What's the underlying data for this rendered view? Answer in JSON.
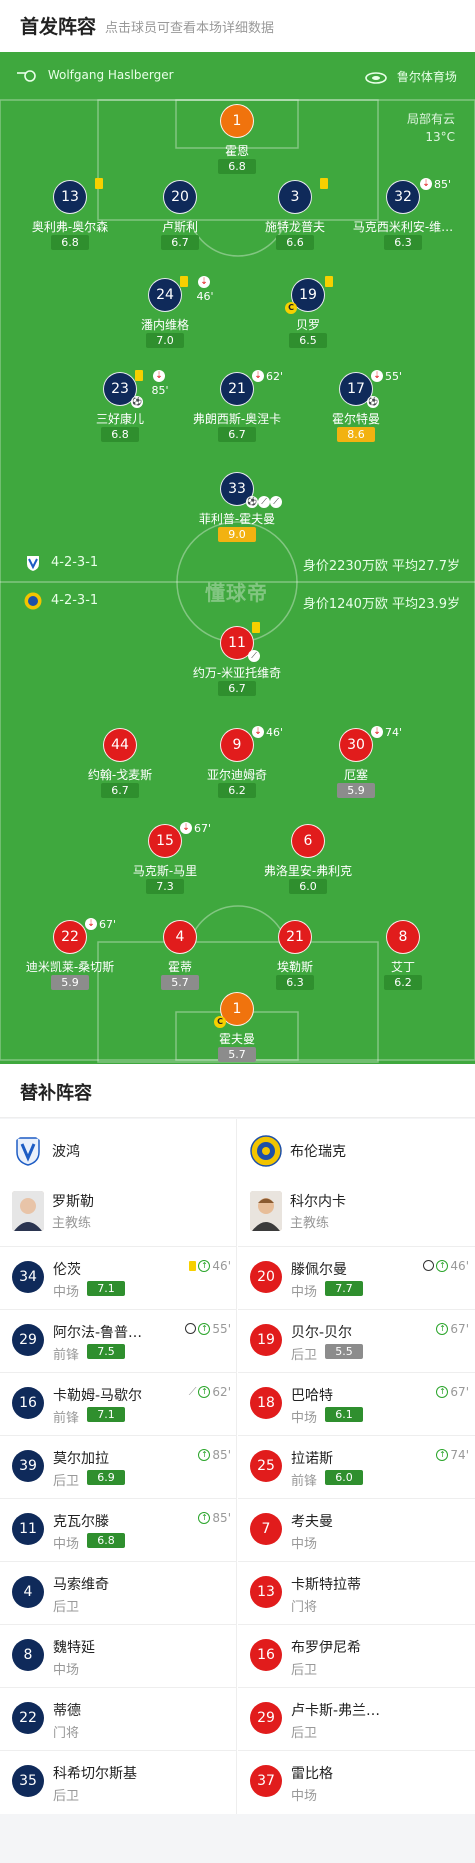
{
  "header": {
    "title": "首发阵容",
    "hint": "点击球员可查看本场详细数据"
  },
  "match_info": {
    "referee": "Wolfgang Haslberger",
    "venue": "鲁尔体育场",
    "weather": "局部有云",
    "temperature": "13°C"
  },
  "home_team": {
    "formation": "4-2-3-1",
    "value": "身价2230万欧 平均27.7岁"
  },
  "away_team": {
    "formation": "4-2-3-1",
    "value": "身价1240万欧 平均23.9岁"
  },
  "watermark": "懂球帝",
  "home_players": [
    {
      "number": "1",
      "name": "霍恩",
      "rating": "6.8"
    },
    {
      "number": "13",
      "name": "奥利弗-奥尔森",
      "rating": "6.8"
    },
    {
      "number": "20",
      "name": "卢斯利",
      "rating": "6.7"
    },
    {
      "number": "3",
      "name": "施特龙普夫",
      "rating": "6.6"
    },
    {
      "number": "32",
      "name": "马克西米利安-维…",
      "rating": "6.3",
      "sub_minute": "85'"
    },
    {
      "number": "24",
      "name": "潘内维格",
      "rating": "7.0",
      "sub_minute": "46'"
    },
    {
      "number": "19",
      "name": "贝罗",
      "rating": "6.5"
    },
    {
      "number": "23",
      "name": "三好康儿",
      "rating": "6.8",
      "sub_minute": "85'"
    },
    {
      "number": "21",
      "name": "弗朗西斯-奥涅卡",
      "rating": "6.7",
      "sub_minute": "62'"
    },
    {
      "number": "17",
      "name": "霍尔特曼",
      "rating": "8.6",
      "sub_minute": "55'"
    },
    {
      "number": "33",
      "name": "菲利普-霍夫曼",
      "rating": "9.0"
    }
  ],
  "away_players": [
    {
      "number": "11",
      "name": "约万-米亚托维奇",
      "rating": "6.7"
    },
    {
      "number": "44",
      "name": "约翰-戈麦斯",
      "rating": "6.7"
    },
    {
      "number": "9",
      "name": "亚尔迪姆奇",
      "rating": "6.2",
      "sub_minute": "46'"
    },
    {
      "number": "30",
      "name": "厄塞",
      "rating": "5.9",
      "sub_minute": "74'"
    },
    {
      "number": "15",
      "name": "马克斯-马里",
      "rating": "7.3",
      "sub_minute": "67'"
    },
    {
      "number": "6",
      "name": "弗洛里安-弗利克",
      "rating": "6.0"
    },
    {
      "number": "22",
      "name": "迪米凯莱-桑切斯",
      "rating": "5.9",
      "sub_minute": "67'"
    },
    {
      "number": "4",
      "name": "霍蒂",
      "rating": "5.7"
    },
    {
      "number": "21",
      "name": "埃勒斯",
      "rating": "6.3"
    },
    {
      "number": "8",
      "name": "艾丁",
      "rating": "6.2"
    },
    {
      "number": "1",
      "name": "霍夫曼",
      "rating": "5.7"
    }
  ],
  "subs": {
    "title": "替补阵容",
    "home": {
      "team": "波鸿",
      "coach": {
        "name": "罗斯勒",
        "role": "主教练"
      },
      "players": [
        {
          "number": "34",
          "name": "伦茨",
          "position": "中场",
          "rating": "7.1",
          "minute": "46'"
        },
        {
          "number": "29",
          "name": "阿尔法-鲁普…",
          "position": "前锋",
          "rating": "7.5",
          "minute": "55'"
        },
        {
          "number": "16",
          "name": "卡勒姆-马歇尔",
          "position": "前锋",
          "rating": "7.1",
          "minute": "62'"
        },
        {
          "number": "39",
          "name": "莫尔加拉",
          "position": "后卫",
          "rating": "6.9",
          "minute": "85'"
        },
        {
          "number": "11",
          "name": "克瓦尔滕",
          "position": "中场",
          "rating": "6.8",
          "minute": "85'"
        },
        {
          "number": "4",
          "name": "马索维奇",
          "position": "后卫"
        },
        {
          "number": "8",
          "name": "魏特延",
          "position": "中场"
        },
        {
          "number": "22",
          "name": "蒂德",
          "position": "门将"
        },
        {
          "number": "35",
          "name": "科希切尔斯基",
          "position": "后卫"
        }
      ]
    },
    "away": {
      "team": "布伦瑞克",
      "coach": {
        "name": "科尔内卡",
        "role": "主教练"
      },
      "players": [
        {
          "number": "20",
          "name": "滕佩尔曼",
          "position": "中场",
          "rating": "7.7",
          "minute": "46'"
        },
        {
          "number": "19",
          "name": "贝尔-贝尔",
          "position": "后卫",
          "rating": "5.5",
          "minute": "67'"
        },
        {
          "number": "18",
          "name": "巴哈特",
          "position": "中场",
          "rating": "6.1",
          "minute": "67'"
        },
        {
          "number": "25",
          "name": "拉诺斯",
          "position": "前锋",
          "rating": "6.0",
          "minute": "74'"
        },
        {
          "number": "7",
          "name": "考夫曼",
          "position": "中场"
        },
        {
          "number": "13",
          "name": "卡斯特拉蒂",
          "position": "门将"
        },
        {
          "number": "16",
          "name": "布罗伊尼希",
          "position": "后卫"
        },
        {
          "number": "29",
          "name": "卢卡斯-弗兰…",
          "position": "后卫"
        },
        {
          "number": "37",
          "name": "雷比格",
          "position": "中场"
        }
      ]
    }
  },
  "colors": {
    "pitch": "#3fa83e",
    "home": "#0f2a5a",
    "away": "#e11c1c",
    "goalkeeper": "#f0730d",
    "rating": "#2f8f2e",
    "best_rating": "#f2b211"
  },
  "icons": [
    "whistle-icon",
    "stadium-icon",
    "yellow-card-icon",
    "sub-out-icon",
    "sub-in-icon",
    "goal-ball-icon",
    "assist-icon",
    "captain-icon"
  ]
}
